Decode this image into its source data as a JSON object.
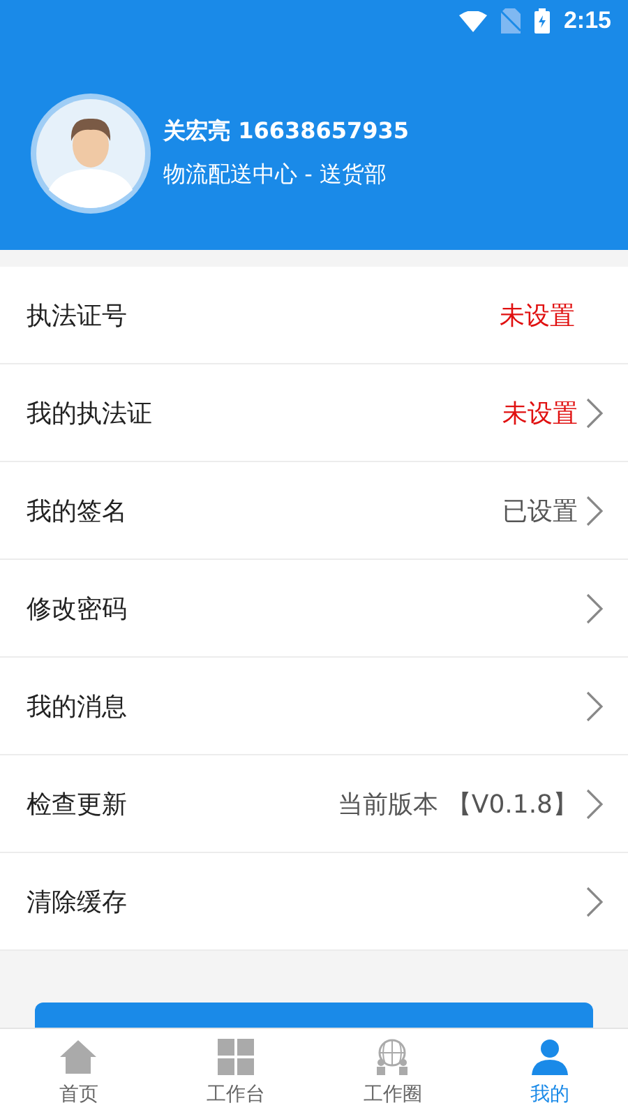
{
  "status_bar": {
    "time": "2:15"
  },
  "profile": {
    "name_line": "关宏亮 16638657935",
    "department": "物流配送中心 - 送货部"
  },
  "menu": [
    {
      "label": "执法证号",
      "value": "未设置",
      "alert": true,
      "chevron": false
    },
    {
      "label": "我的执法证",
      "value": "未设置",
      "alert": true,
      "chevron": true
    },
    {
      "label": "我的签名",
      "value": "已设置",
      "alert": false,
      "chevron": true
    },
    {
      "label": "修改密码",
      "chevron": true
    },
    {
      "label": "我的消息",
      "chevron": true
    },
    {
      "label": "检查更新",
      "value": "当前版本 【V0.1.8】",
      "alert": false,
      "chevron": true
    },
    {
      "label": "清除缓存",
      "chevron": true
    }
  ],
  "tab_bar": [
    {
      "label": "首页",
      "kind": "home",
      "selected": false
    },
    {
      "label": "工作台",
      "kind": "grid",
      "selected": false
    },
    {
      "label": "工作圈",
      "kind": "globe",
      "selected": false
    },
    {
      "label": "我的",
      "kind": "person",
      "selected": true
    }
  ]
}
